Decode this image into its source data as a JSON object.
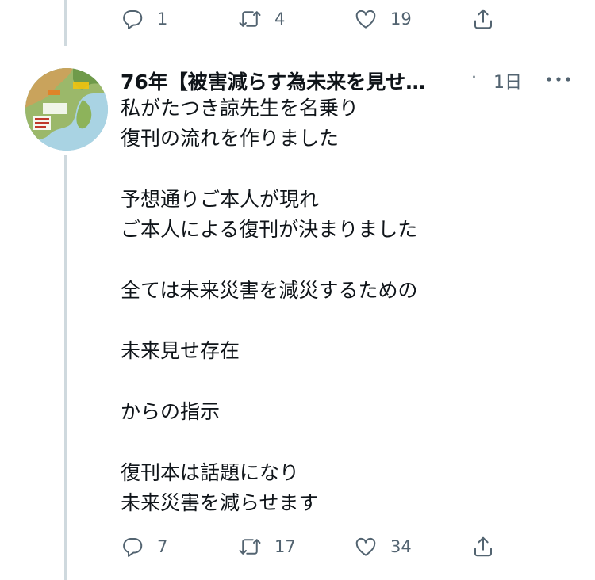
{
  "previous_tweet": {
    "actions": {
      "reply_count": "1",
      "retweet_count": "4",
      "like_count": "19"
    }
  },
  "tweet": {
    "author_name": "76年【被害減らす為未来を見せ…",
    "separator": "·",
    "time": "1日",
    "text": "私がたつき諒先生を名乗り\n復刊の流れを作りました\n\n予想通りご本人が現れ\nご本人による復刊が決まりました\n\n全ては未来災害を減災するための\n\n未来見せ存在\n\nからの指示\n\n復刊本は話題になり\n未来災害を減らせます",
    "actions": {
      "reply_count": "7",
      "retweet_count": "17",
      "like_count": "34"
    }
  },
  "icons": {
    "reply": "reply-icon",
    "retweet": "retweet-icon",
    "like": "heart-icon",
    "share": "share-icon",
    "more": "more-icon"
  },
  "colors": {
    "text_primary": "#0f1419",
    "text_secondary": "#536471",
    "thread_line": "#cfd9de",
    "background": "#ffffff"
  }
}
